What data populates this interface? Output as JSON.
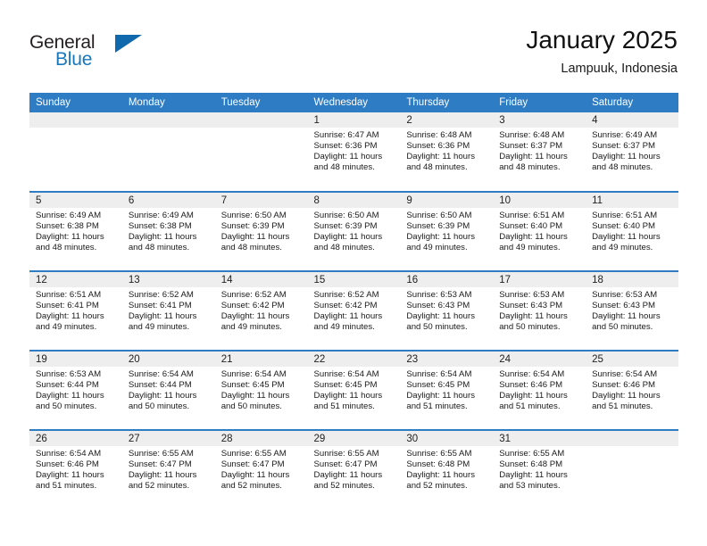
{
  "brand": {
    "word1": "General",
    "word2": "Blue",
    "triangle_color": "#1068ad"
  },
  "header": {
    "title": "January 2025",
    "subtitle": "Lampuuk, Indonesia"
  },
  "theme": {
    "header_bg": "#2e7cc4",
    "daynum_bg": "#eeeeee",
    "row_border": "#2e7cc4"
  },
  "weekdays": [
    "Sunday",
    "Monday",
    "Tuesday",
    "Wednesday",
    "Thursday",
    "Friday",
    "Saturday"
  ],
  "weeks": [
    [
      {
        "day": "",
        "empty": true
      },
      {
        "day": "",
        "empty": true
      },
      {
        "day": "",
        "empty": true
      },
      {
        "day": "1",
        "sunrise": "Sunrise: 6:47 AM",
        "sunset": "Sunset: 6:36 PM",
        "daylight1": "Daylight: 11 hours",
        "daylight2": "and 48 minutes."
      },
      {
        "day": "2",
        "sunrise": "Sunrise: 6:48 AM",
        "sunset": "Sunset: 6:36 PM",
        "daylight1": "Daylight: 11 hours",
        "daylight2": "and 48 minutes."
      },
      {
        "day": "3",
        "sunrise": "Sunrise: 6:48 AM",
        "sunset": "Sunset: 6:37 PM",
        "daylight1": "Daylight: 11 hours",
        "daylight2": "and 48 minutes."
      },
      {
        "day": "4",
        "sunrise": "Sunrise: 6:49 AM",
        "sunset": "Sunset: 6:37 PM",
        "daylight1": "Daylight: 11 hours",
        "daylight2": "and 48 minutes."
      }
    ],
    [
      {
        "day": "5",
        "sunrise": "Sunrise: 6:49 AM",
        "sunset": "Sunset: 6:38 PM",
        "daylight1": "Daylight: 11 hours",
        "daylight2": "and 48 minutes."
      },
      {
        "day": "6",
        "sunrise": "Sunrise: 6:49 AM",
        "sunset": "Sunset: 6:38 PM",
        "daylight1": "Daylight: 11 hours",
        "daylight2": "and 48 minutes."
      },
      {
        "day": "7",
        "sunrise": "Sunrise: 6:50 AM",
        "sunset": "Sunset: 6:39 PM",
        "daylight1": "Daylight: 11 hours",
        "daylight2": "and 48 minutes."
      },
      {
        "day": "8",
        "sunrise": "Sunrise: 6:50 AM",
        "sunset": "Sunset: 6:39 PM",
        "daylight1": "Daylight: 11 hours",
        "daylight2": "and 48 minutes."
      },
      {
        "day": "9",
        "sunrise": "Sunrise: 6:50 AM",
        "sunset": "Sunset: 6:39 PM",
        "daylight1": "Daylight: 11 hours",
        "daylight2": "and 49 minutes."
      },
      {
        "day": "10",
        "sunrise": "Sunrise: 6:51 AM",
        "sunset": "Sunset: 6:40 PM",
        "daylight1": "Daylight: 11 hours",
        "daylight2": "and 49 minutes."
      },
      {
        "day": "11",
        "sunrise": "Sunrise: 6:51 AM",
        "sunset": "Sunset: 6:40 PM",
        "daylight1": "Daylight: 11 hours",
        "daylight2": "and 49 minutes."
      }
    ],
    [
      {
        "day": "12",
        "sunrise": "Sunrise: 6:51 AM",
        "sunset": "Sunset: 6:41 PM",
        "daylight1": "Daylight: 11 hours",
        "daylight2": "and 49 minutes."
      },
      {
        "day": "13",
        "sunrise": "Sunrise: 6:52 AM",
        "sunset": "Sunset: 6:41 PM",
        "daylight1": "Daylight: 11 hours",
        "daylight2": "and 49 minutes."
      },
      {
        "day": "14",
        "sunrise": "Sunrise: 6:52 AM",
        "sunset": "Sunset: 6:42 PM",
        "daylight1": "Daylight: 11 hours",
        "daylight2": "and 49 minutes."
      },
      {
        "day": "15",
        "sunrise": "Sunrise: 6:52 AM",
        "sunset": "Sunset: 6:42 PM",
        "daylight1": "Daylight: 11 hours",
        "daylight2": "and 49 minutes."
      },
      {
        "day": "16",
        "sunrise": "Sunrise: 6:53 AM",
        "sunset": "Sunset: 6:43 PM",
        "daylight1": "Daylight: 11 hours",
        "daylight2": "and 50 minutes."
      },
      {
        "day": "17",
        "sunrise": "Sunrise: 6:53 AM",
        "sunset": "Sunset: 6:43 PM",
        "daylight1": "Daylight: 11 hours",
        "daylight2": "and 50 minutes."
      },
      {
        "day": "18",
        "sunrise": "Sunrise: 6:53 AM",
        "sunset": "Sunset: 6:43 PM",
        "daylight1": "Daylight: 11 hours",
        "daylight2": "and 50 minutes."
      }
    ],
    [
      {
        "day": "19",
        "sunrise": "Sunrise: 6:53 AM",
        "sunset": "Sunset: 6:44 PM",
        "daylight1": "Daylight: 11 hours",
        "daylight2": "and 50 minutes."
      },
      {
        "day": "20",
        "sunrise": "Sunrise: 6:54 AM",
        "sunset": "Sunset: 6:44 PM",
        "daylight1": "Daylight: 11 hours",
        "daylight2": "and 50 minutes."
      },
      {
        "day": "21",
        "sunrise": "Sunrise: 6:54 AM",
        "sunset": "Sunset: 6:45 PM",
        "daylight1": "Daylight: 11 hours",
        "daylight2": "and 50 minutes."
      },
      {
        "day": "22",
        "sunrise": "Sunrise: 6:54 AM",
        "sunset": "Sunset: 6:45 PM",
        "daylight1": "Daylight: 11 hours",
        "daylight2": "and 51 minutes."
      },
      {
        "day": "23",
        "sunrise": "Sunrise: 6:54 AM",
        "sunset": "Sunset: 6:45 PM",
        "daylight1": "Daylight: 11 hours",
        "daylight2": "and 51 minutes."
      },
      {
        "day": "24",
        "sunrise": "Sunrise: 6:54 AM",
        "sunset": "Sunset: 6:46 PM",
        "daylight1": "Daylight: 11 hours",
        "daylight2": "and 51 minutes."
      },
      {
        "day": "25",
        "sunrise": "Sunrise: 6:54 AM",
        "sunset": "Sunset: 6:46 PM",
        "daylight1": "Daylight: 11 hours",
        "daylight2": "and 51 minutes."
      }
    ],
    [
      {
        "day": "26",
        "sunrise": "Sunrise: 6:54 AM",
        "sunset": "Sunset: 6:46 PM",
        "daylight1": "Daylight: 11 hours",
        "daylight2": "and 51 minutes."
      },
      {
        "day": "27",
        "sunrise": "Sunrise: 6:55 AM",
        "sunset": "Sunset: 6:47 PM",
        "daylight1": "Daylight: 11 hours",
        "daylight2": "and 52 minutes."
      },
      {
        "day": "28",
        "sunrise": "Sunrise: 6:55 AM",
        "sunset": "Sunset: 6:47 PM",
        "daylight1": "Daylight: 11 hours",
        "daylight2": "and 52 minutes."
      },
      {
        "day": "29",
        "sunrise": "Sunrise: 6:55 AM",
        "sunset": "Sunset: 6:47 PM",
        "daylight1": "Daylight: 11 hours",
        "daylight2": "and 52 minutes."
      },
      {
        "day": "30",
        "sunrise": "Sunrise: 6:55 AM",
        "sunset": "Sunset: 6:48 PM",
        "daylight1": "Daylight: 11 hours",
        "daylight2": "and 52 minutes."
      },
      {
        "day": "31",
        "sunrise": "Sunrise: 6:55 AM",
        "sunset": "Sunset: 6:48 PM",
        "daylight1": "Daylight: 11 hours",
        "daylight2": "and 53 minutes."
      },
      {
        "day": "",
        "empty": true
      }
    ]
  ]
}
